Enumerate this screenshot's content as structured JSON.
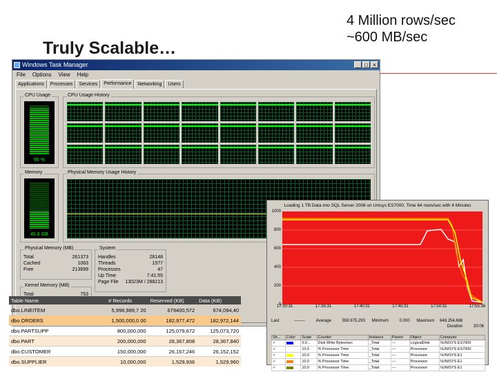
{
  "slide": {
    "title": "Truly Scalable…",
    "subtitle_line1": "4 Million rows/sec",
    "subtitle_line2": "~600 MB/sec"
  },
  "task_manager": {
    "window_title": "Windows Task Manager",
    "menu": [
      "File",
      "Options",
      "View",
      "Help"
    ],
    "tabs": [
      "Applications",
      "Processes",
      "Services",
      "Performance",
      "Networking",
      "Users"
    ],
    "active_tab": "Performance",
    "cpu_usage_label": "CPU Usage",
    "cpu_usage_value": "95 %",
    "cpu_usage_level": 0.95,
    "cpu_history_label": "CPU Usage History",
    "memory_label": "Memory",
    "memory_value": "45.6 GB",
    "memory_level": 0.38,
    "memory_history_label": "Physical Memory Usage History",
    "physical_memory": {
      "label": "Physical Memory (MB)",
      "rows": [
        [
          "Total",
          "261373"
        ],
        [
          "Cached",
          "1063"
        ],
        [
          "Free",
          "213699"
        ]
      ]
    },
    "system": {
      "label": "System",
      "rows": [
        [
          "Handles",
          "28148"
        ],
        [
          "Threads",
          "1577"
        ],
        [
          "Processes",
          "47"
        ],
        [
          "Up Time",
          "7:41:55"
        ],
        [
          "Page File",
          "13023M / 288213"
        ]
      ]
    },
    "kernel_memory": {
      "label": "Kernel Memory (MB)",
      "rows": [
        [
          "Total",
          "753"
        ]
      ]
    }
  },
  "table": {
    "headers": [
      "Table Name",
      "# Records",
      "Reserved (KB)",
      "Data (KB)"
    ],
    "rows": [
      [
        "dbo.LINEITEM",
        "5,998,989,7\n20",
        "679400,572",
        "674,094,40"
      ],
      [
        "dbo.ORDERS",
        "1,500,000,0\n00",
        "182,977,472",
        "182,972,144"
      ],
      [
        "dbo.PARTSUPP",
        "800,000,000",
        "125,079,672",
        "125,073,720"
      ],
      [
        "dbo.PART",
        "200,000,000",
        "28,367,808",
        "28,367,840"
      ],
      [
        "dbo.CUSTOMER",
        "150,000,000",
        "26,167,246",
        "26,152,152"
      ],
      [
        "dbo.SUPPLIER",
        "10,000,000",
        "1,529,936",
        "1,529,960"
      ]
    ]
  },
  "perfmon": {
    "header": "Loading 1 TB Data into SQL Server 2008 on Unisys ES7000, Time 64 rows/sec with 4 Minutes",
    "y_ticks": [
      "1000",
      "800",
      "600",
      "400",
      "200",
      "0"
    ],
    "x_ticks": [
      "17:30:31",
      "17:35:31",
      "17:40:31",
      "17:45:31",
      "17:50:31",
      "17:55:36"
    ],
    "stats": {
      "last_label": "Last",
      "last_value": "--------",
      "average_label": "Average",
      "average_value": "559.975,293",
      "minimum_label": "Minimum",
      "minimum_value": "0.000",
      "maximum_label": "Maximum",
      "maximum_value": "648.254,668",
      "duration_label": "Duration",
      "duration_value": "20:06"
    },
    "counters": {
      "headers": [
        "Sh...",
        "Color",
        "Scale",
        "Counter",
        "Instance",
        "Parent",
        "Object",
        "Computer"
      ],
      "rows": [
        [
          "✓",
          "#0000ff",
          "0.0...",
          "Disk Write Bytes/sec",
          "_Total",
          "---",
          "LogicalDisk",
          "\\\\UNISYS ES7000"
        ],
        [
          "✓",
          "#ffffff",
          "10.0",
          "% Processor Time",
          "_Total",
          "---",
          "Processor",
          "\\\\UNISYS ES7000"
        ],
        [
          "✓",
          "#ffff00",
          "10.0",
          "% Processor Time",
          "_Total",
          "---",
          "Processor",
          "\\\\UNISYS E1"
        ],
        [
          "✓",
          "#ff8000",
          "10.0",
          "% Processor Time",
          "_Total",
          "---",
          "Processor",
          "\\\\UNISYS E1"
        ],
        [
          "✓",
          "#808000",
          "10.0",
          "% Processor Time",
          "_Total",
          "---",
          "Processor",
          "\\\\UNISYS E1"
        ]
      ]
    }
  },
  "colors": {
    "chart_bg": "#ee1a1a",
    "accent_red": "#cc3333",
    "meter_green": "#00c000"
  }
}
